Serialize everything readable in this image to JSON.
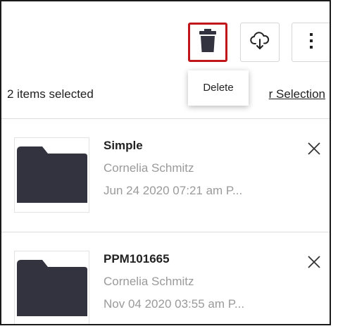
{
  "toolbar": {
    "delete_icon": "trash-icon",
    "download_icon": "cloud-download-icon",
    "more_icon": "more-vertical-icon",
    "delete_highlight_color": "#c0151a"
  },
  "tooltip": {
    "text": "Delete"
  },
  "selection": {
    "count_label": "2 items selected",
    "clear_label": "r Selection"
  },
  "items": [
    {
      "name": "Simple",
      "owner": "Cornelia Schmitz",
      "date": "Jun 24 2020 07:21 am P...",
      "icon": "folder-icon"
    },
    {
      "name": "PPM101665",
      "owner": "Cornelia Schmitz",
      "date": "Nov 04 2020 03:55 am P...",
      "icon": "folder-icon"
    }
  ],
  "colors": {
    "folder": "#33333f",
    "secondary_text": "#9a9a9a"
  }
}
